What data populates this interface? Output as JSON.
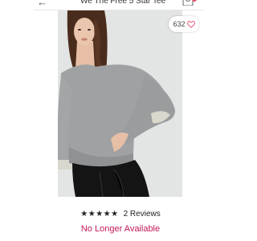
{
  "header": {
    "title": "We The Free 5 Star Tee",
    "back_icon": "back-arrow-icon",
    "bag_icon": "shopping-bag-icon"
  },
  "product": {
    "likes_count": "632",
    "heart_icon": "heart-outline-icon",
    "accent_color": "#e64b6a"
  },
  "rating": {
    "stars": "★★★★★",
    "reviews_label": "2 Reviews"
  },
  "availability": {
    "status": "No Longer Available",
    "color": "#c2185b"
  }
}
